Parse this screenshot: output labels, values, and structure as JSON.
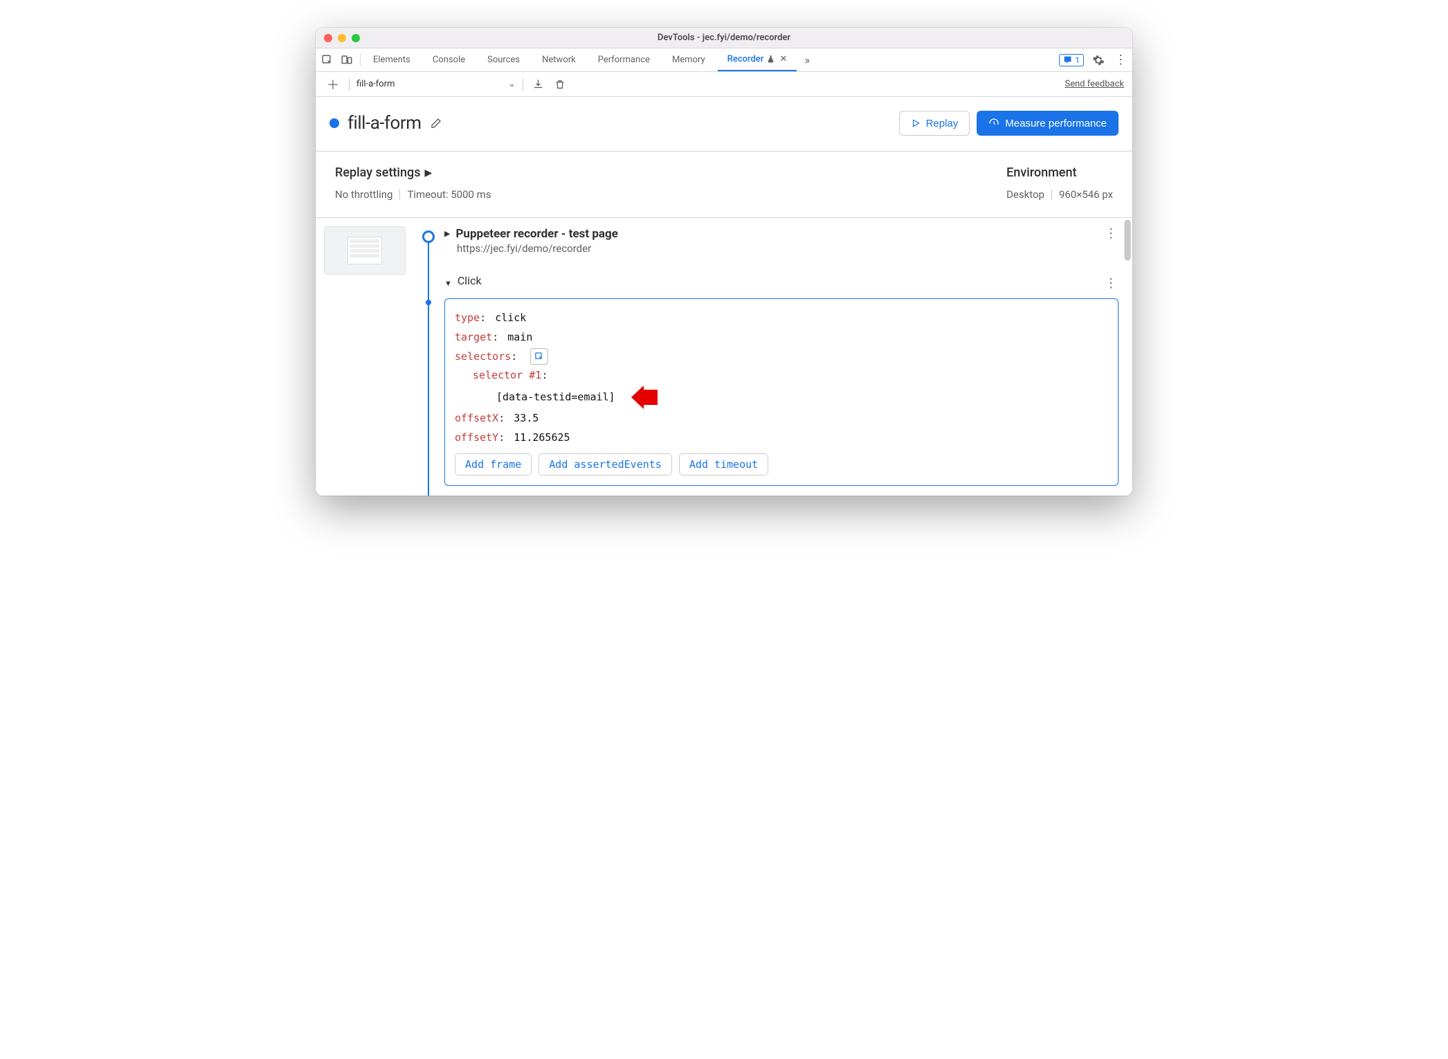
{
  "window": {
    "title": "DevTools - jec.fyi/demo/recorder"
  },
  "tabs": {
    "items": [
      "Elements",
      "Console",
      "Sources",
      "Network",
      "Performance",
      "Memory",
      "Recorder"
    ],
    "active": "Recorder",
    "badge_count": "1"
  },
  "toolbar": {
    "recording_name": "fill-a-form",
    "send_feedback": "Send feedback"
  },
  "header": {
    "title": "fill-a-form",
    "replay_label": "Replay",
    "measure_label": "Measure performance"
  },
  "settings": {
    "replay": {
      "title": "Replay settings",
      "throttling": "No throttling",
      "timeout": "Timeout: 5000 ms"
    },
    "env": {
      "title": "Environment",
      "device": "Desktop",
      "size": "960×546 px"
    }
  },
  "steps": {
    "first": {
      "title": "Puppeteer recorder - test page",
      "url": "https://jec.fyi/demo/recorder"
    },
    "click": {
      "title": "Click",
      "type_key": "type",
      "type_val": "click",
      "target_key": "target",
      "target_val": "main",
      "selectors_key": "selectors",
      "selector_label": "selector #1",
      "selector_val": "[data-testid=email]",
      "offsetX_key": "offsetX",
      "offsetX_val": "33.5",
      "offsetY_key": "offsetY",
      "offsetY_val": "11.265625",
      "add_frame": "Add frame",
      "add_asserted": "Add assertedEvents",
      "add_timeout": "Add timeout"
    }
  }
}
